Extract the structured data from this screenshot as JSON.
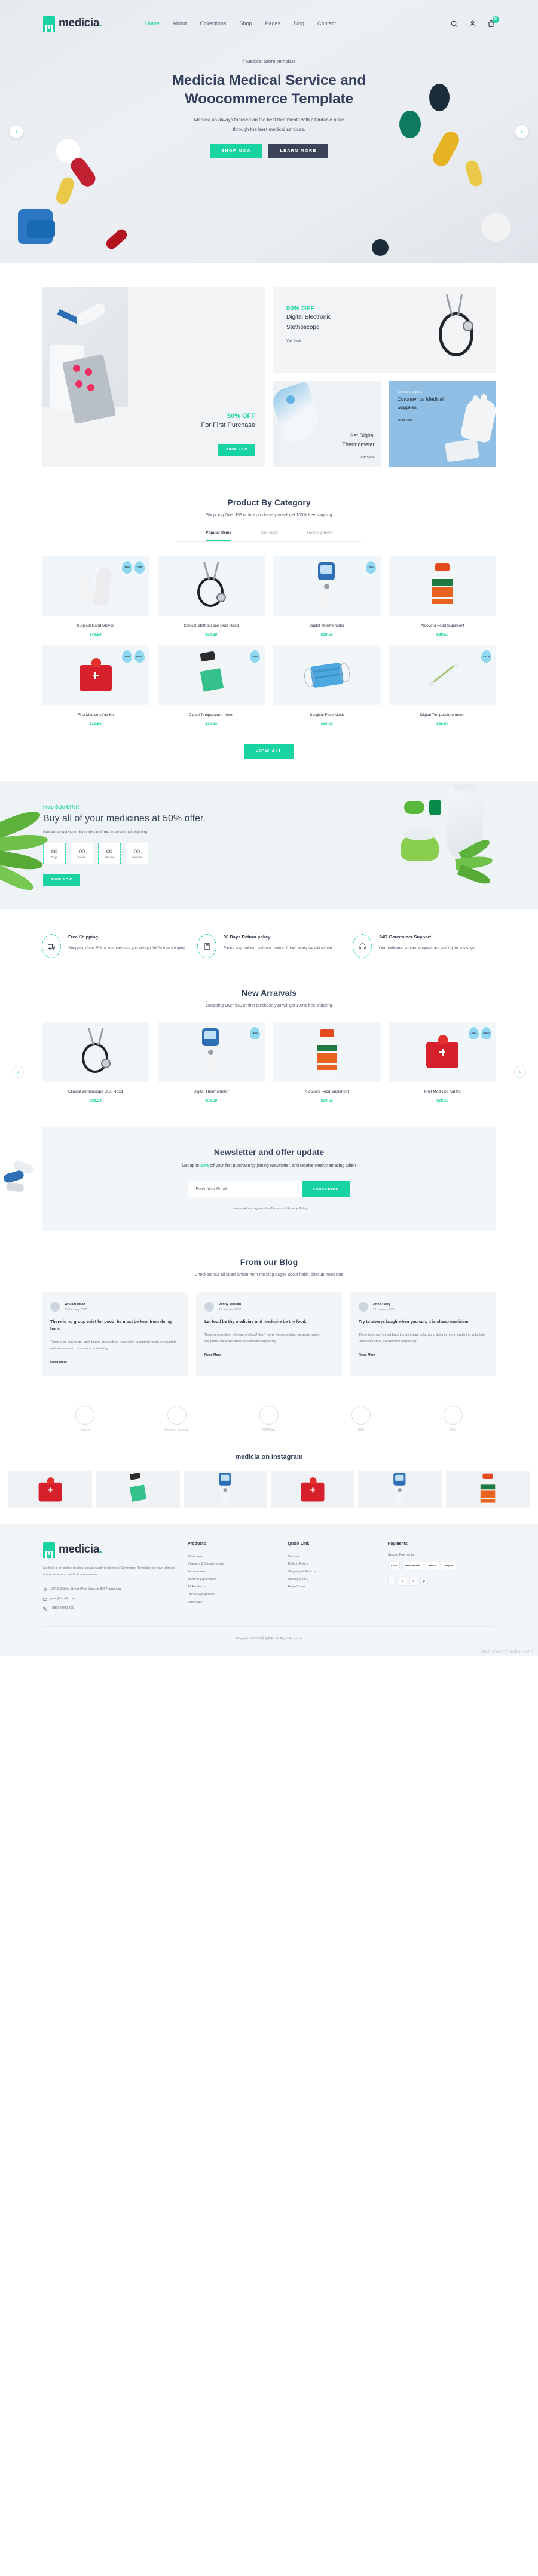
{
  "header": {
    "logo_text": "medicia",
    "logo_dot": ".",
    "logo_letter": "m",
    "nav": [
      {
        "label": "Home",
        "active": true
      },
      {
        "label": "About",
        "active": false
      },
      {
        "label": "Collections",
        "active": false
      },
      {
        "label": "Shop",
        "active": false
      },
      {
        "label": "Pages",
        "active": false
      },
      {
        "label": "Blog",
        "active": false
      },
      {
        "label": "Contact",
        "active": false
      }
    ],
    "cart_count": "03"
  },
  "hero": {
    "kicker": "# Medical Store Template",
    "title_line1": "Medicia Medical Service and",
    "title_line2": "Woocommerce Template",
    "subtitle_line1": "Medicia as always focused on the best treatments with affordable price",
    "subtitle_line2": "through the best medical services.",
    "btn_primary": "SHOP NOW",
    "btn_secondary": "LEARN MORE",
    "prev": "‹",
    "next": "›"
  },
  "promo": {
    "first_purchase": {
      "off": "50% OFF",
      "title": "For First Purchase",
      "button": "SHOP NOW"
    },
    "stethoscope": {
      "off": "50% OFF",
      "title_line1": "Digital Electronic",
      "title_line2": "Stethoscope",
      "link": "Visit Store"
    },
    "thermometer": {
      "title_line1": "Get Digital",
      "title_line2": "Thermometer",
      "link": "Visit Store"
    },
    "corona": {
      "kicker": "Medical Supplies",
      "title_line1": "Coronavirus Medical",
      "title_line2": "Supplies",
      "link": "Shop Now"
    }
  },
  "category": {
    "title": "Product By Category",
    "subtitle": "Shopping Over $59 or first purchase you will get 100% free shipping",
    "tabs": [
      {
        "label": "Popular Items",
        "active": true
      },
      {
        "label": "Top Rated",
        "active": false
      },
      {
        "label": "Trending Items",
        "active": false
      }
    ],
    "view_all": "VIEW ALL",
    "products": [
      {
        "name": "Surgical Hand Gloves",
        "price": "$49.50",
        "badges": [
          "-19%",
          "TOP"
        ],
        "kind": "gloves"
      },
      {
        "name": "Clinical Stethoscope Dual Head",
        "price": "$39.50",
        "badges": [],
        "kind": "stethoscope"
      },
      {
        "name": "Digital Thermometer",
        "price": "$39.50",
        "badges": [
          "-30%"
        ],
        "kind": "thermometer"
      },
      {
        "name": "Aloevera Food Supliment",
        "price": "$39.50",
        "badges": [],
        "kind": "aloevera"
      },
      {
        "name": "First Medicine Aid Kit",
        "price": "$29.50",
        "badges": [
          "-19%",
          "NEW"
        ],
        "kind": "aidkit"
      },
      {
        "name": "Digital Temparature meter",
        "price": "$39.00",
        "badges": [
          "-20%"
        ],
        "kind": "pillbottle"
      },
      {
        "name": "Surgical Face Mask",
        "price": "$39.00",
        "badges": [],
        "kind": "mask"
      },
      {
        "name": "Digital Temparature meter",
        "price": "$39.50",
        "badges": [
          "SALE"
        ],
        "kind": "glassthermo"
      }
    ]
  },
  "sale": {
    "kicker": "Intro Sale Offer!",
    "title": "Buy all of your medicines at 50% offer.",
    "subtitle": "Get extra cashback discounts and free international shipping.",
    "button": "SHOP NOW",
    "counters": [
      {
        "value": "00",
        "label": "Days"
      },
      {
        "value": "00",
        "label": "Hours"
      },
      {
        "value": "00",
        "label": "Minutes"
      },
      {
        "value": "00",
        "label": "Seconds"
      }
    ]
  },
  "features": [
    {
      "icon": "truck-icon",
      "title": "Free Shipping",
      "desc": "Shopping Over $59 or first purchase you will get 100% free shipping"
    },
    {
      "icon": "box-return-icon",
      "title": "30 Days Return policy",
      "desc": "Faces any problem with our product? don't worry we will refund."
    },
    {
      "icon": "headset-icon",
      "title": "24/7 Coustomer Support",
      "desc": "Our dedicated support engneer are waiting for assist you."
    }
  ],
  "arrivals": {
    "title": "New Arraivals",
    "subtitle": "Shopping Over $59 or first purchase you will get 100% free shipping",
    "prev": "‹",
    "next": "›",
    "products": [
      {
        "name": "Clinical Stethoscope Dual Head",
        "price": "$39.50",
        "badges": [],
        "kind": "stethoscope"
      },
      {
        "name": "Digital Thermometer",
        "price": "$39.50",
        "badges": [
          "-30%"
        ],
        "kind": "thermometer"
      },
      {
        "name": "Aloevera Food Supliment",
        "price": "$39.50",
        "badges": [],
        "kind": "aloevera"
      },
      {
        "name": "First Medicine Aid Kit",
        "price": "$29.50",
        "badges": [
          "-19%",
          "NEW"
        ],
        "kind": "aidkit"
      }
    ]
  },
  "newsletter": {
    "title": "Newsletter and offer update",
    "sub_pre": "Get up to ",
    "sub_highlight": "30%",
    "sub_post": " off your first purchase by joining Newsletter, and receive weekly amazing Offer!",
    "placeholder": "Enter Your Email",
    "button": "SUBSCRIBE",
    "consent": "I have read and agreed the Terms and Privacy Policy"
  },
  "blog": {
    "title": "From our Blog",
    "subtitle": "Checkout our all latest article from the blog pages about helth. checup, medicine",
    "posts": [
      {
        "author": "William Milan",
        "date": "21 January 2020",
        "title": "There is no group exist for good, he must be kept from doing harm.",
        "excerpt": "There is no way to get back Lorem ipsum dolor nunc dolor in reprehenderit in voluptate velit esdw amet, consectetur adipisicing.",
        "more": "Read More"
      },
      {
        "author": "Johny Jonson",
        "date": "21 January 2020",
        "title": "Let food be thy medicine and medicine be thy food.",
        "excerpt": "There are problem with our product? don't worry we are waiting for assist you in voluptate velit esdw amet, consectetur adipisicing.",
        "more": "Read More"
      },
      {
        "author": "Anna Parry",
        "date": "21 January 2020",
        "title": "Try to always laugh when you can, it is cheap medicine.",
        "excerpt": "There is no way to get back Lorem ipsum dolor nunc dolor in reprehenderit in voluptate velit esdw amet, consectetur adipisicing.",
        "more": "Read More"
      }
    ]
  },
  "brands": [
    {
      "label": "medicia"
    },
    {
      "label": "Design + Branding"
    },
    {
      "label": "MEDIKAL"
    },
    {
      "label": "D&S"
    },
    {
      "label": "D&S"
    }
  ],
  "instagram": {
    "title": "medicia on Instagram",
    "cells": [
      "aidkit",
      "pillbottle",
      "thermometer",
      "aidkit",
      "thermometer",
      "aloevera"
    ]
  },
  "footer": {
    "logo_text": "medicia",
    "about": "Medicia is an online medical service and medicines/eCommerce Template for your ultimate online store and medical ecommerce.",
    "contact": [
      {
        "icon": "pin-icon",
        "text": "18/18 Collins Street West Victoria 8007 Australia"
      },
      {
        "icon": "mail-icon",
        "text": "your@email.com"
      },
      {
        "icon": "phone-icon",
        "text": "+88002 000 800"
      }
    ],
    "columns": [
      {
        "heading": "Products",
        "links": [
          "Medicines",
          "Vitamins & Supplements",
          "Accessories",
          "Medical Equipment",
          "All Products",
          "Doctor Equipment",
          "Offer Sale"
        ]
      },
      {
        "heading": "Quick Link",
        "links": [
          "Support",
          "Refund Policy",
          "Shipping & Returns",
          "Privacy Policy",
          "Help Center"
        ]
      }
    ],
    "payments": {
      "heading": "Payments",
      "secure_label": "Secure Payments",
      "methods": [
        "VISA",
        "mastercard",
        "AMEX",
        "PayPal"
      ]
    },
    "social": [
      "f",
      "t",
      "in",
      "p"
    ],
    "copyright": "©Copyright 2020 ® 网站模板 . All Rights Reserved."
  },
  "watermark": "https://www.huahan.com"
}
